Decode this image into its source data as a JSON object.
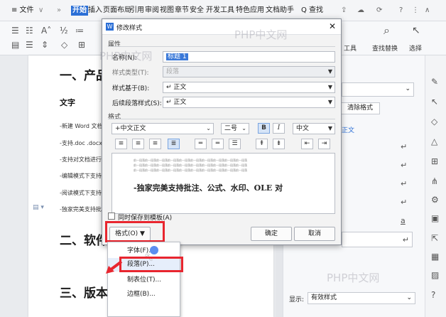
{
  "menubar": {
    "file": "≡ 文件",
    "tabs": [
      "开始",
      "插入",
      "页面布局",
      "引用",
      "审阅",
      "视图",
      "章节",
      "安全",
      "开发工具",
      "特色应用",
      "文档助手"
    ],
    "search": "Q 查找",
    "active_tab": "开始"
  },
  "toolbar": {
    "find_replace": "查找替换",
    "select": "选择",
    "tools": "工具"
  },
  "document": {
    "heading1": "一、产品",
    "subheading": "文字",
    "bullets": [
      "-新建 Word 文档",
      "-支持.doc .docx",
      "-支持对文档进行",
      "-编辑模式下支持",
      "-阅读模式下支持",
      "-独家完美支持批"
    ],
    "heading2": "二、软件",
    "heading3": "三、版本"
  },
  "right_pane": {
    "clear_format": "清除格式",
    "text_label": "正文",
    "show_label": "显示:",
    "show_value": "有效样式"
  },
  "dialog": {
    "title": "修改样式",
    "section_props": "属性",
    "name_label": "名称(N):",
    "name_value": "标题 1",
    "type_label": "样式类型(T):",
    "type_value": "段落",
    "based_label": "样式基于(B):",
    "based_value": "↵ 正文",
    "next_label": "后续段落样式(S):",
    "next_value": "↵ 正文",
    "section_format": "格式",
    "font_value": "+中文正文",
    "size_value": "二号",
    "bold": "B",
    "italic": "I",
    "lang_value": "中文",
    "preview_text": "-独家完美支持批注、公式、水印、OLE 对",
    "preview_filler": "前一段落前一段落前一段落前一段落前一段落前一段落前一段落前一段落前一段落前一段落",
    "save_template": "同时保存到模板(A)",
    "format_button": "格式(O) ▼",
    "ok": "确定",
    "cancel": "取消"
  },
  "popup_menu": {
    "items": [
      "字体(F)...",
      "段落(P)...",
      "制表位(T)...",
      "边框(B)..."
    ]
  },
  "watermark": "PHP中文网",
  "colors": {
    "accent": "#2b6fd6",
    "highlight": "#e8262f"
  }
}
